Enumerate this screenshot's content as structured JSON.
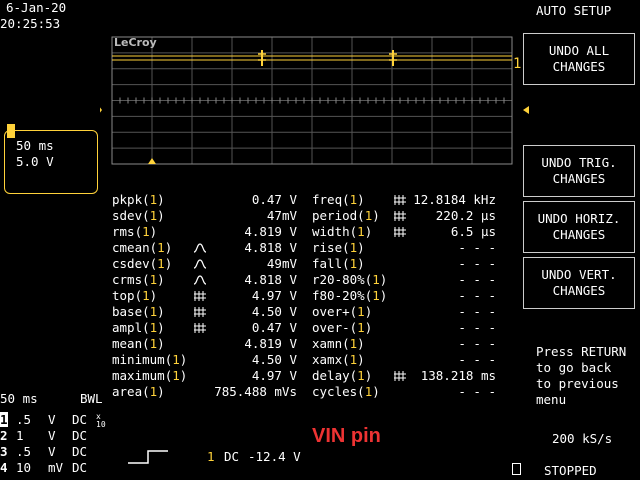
{
  "header": {
    "date": "6-Jan-20",
    "time": "20:25:53",
    "mode": "AUTO SETUP"
  },
  "grid": {
    "logo": "LeCroy"
  },
  "timebase_box": {
    "time_div": "50 ms",
    "volt_div": "5.0 V"
  },
  "buttons": [
    {
      "line1": "UNDO ALL",
      "line2": "CHANGES"
    },
    {
      "line1": "UNDO TRIG.",
      "line2": "CHANGES"
    },
    {
      "line1": "UNDO HORIZ.",
      "line2": "CHANGES"
    },
    {
      "line1": "UNDO VERT.",
      "line2": "CHANGES"
    }
  ],
  "measurements_left": [
    {
      "name": "pkpk",
      "value": "0.47 V",
      "icon": ""
    },
    {
      "name": "sdev",
      "value": "47mV",
      "icon": ""
    },
    {
      "name": "rms",
      "value": "4.819 V",
      "icon": ""
    },
    {
      "name": "cmean",
      "value": "4.818 V",
      "icon": "trend"
    },
    {
      "name": "csdev",
      "value": "49mV",
      "icon": "trend"
    },
    {
      "name": "crms",
      "value": "4.818 V",
      "icon": "trend"
    },
    {
      "name": "top",
      "value": "4.97 V",
      "icon": "jitter"
    },
    {
      "name": "base",
      "value": "4.50 V",
      "icon": "jitter"
    },
    {
      "name": "ampl",
      "value": "0.47 V",
      "icon": "jitter"
    },
    {
      "name": "mean",
      "value": "4.819 V",
      "icon": ""
    },
    {
      "name": "minimum",
      "value": "4.50 V",
      "icon": ""
    },
    {
      "name": "maximum",
      "value": "4.97 V",
      "icon": ""
    },
    {
      "name": "area",
      "value": "785.488 mVs",
      "icon": ""
    }
  ],
  "measurements_right": [
    {
      "name": "freq",
      "value": "12.8184 kHz",
      "icon": "jitter"
    },
    {
      "name": "period",
      "value": "220.2 µs",
      "icon": "jitter"
    },
    {
      "name": "width",
      "value": "6.5 µs",
      "icon": "jitter"
    },
    {
      "name": "rise",
      "value": "- - -",
      "icon": ""
    },
    {
      "name": "fall",
      "value": "- - -",
      "icon": ""
    },
    {
      "name": "r20-80%",
      "value": "- - -",
      "icon": ""
    },
    {
      "name": "f80-20%",
      "value": "- - -",
      "icon": ""
    },
    {
      "name": "over+",
      "value": "- - -",
      "icon": ""
    },
    {
      "name": "over-",
      "value": "- - -",
      "icon": ""
    },
    {
      "name": "xamn",
      "value": "- - -",
      "icon": ""
    },
    {
      "name": "xamx",
      "value": "- - -",
      "icon": ""
    },
    {
      "name": "delay",
      "value": "138.218 ms",
      "icon": "jitter"
    },
    {
      "name": "cycles",
      "value": "- - -",
      "icon": ""
    }
  ],
  "channel_suffix": "(1)",
  "bottom_left": {
    "timebase": "50 ms",
    "bwl": "BWL",
    "channels": [
      {
        "num": "1",
        "scale": ".5",
        "unit": "V",
        "coupling": "DC"
      },
      {
        "num": "2",
        "scale": "1",
        "unit": "V",
        "coupling": "DC"
      },
      {
        "num": "3",
        "scale": ".5",
        "unit": "V",
        "coupling": "DC"
      },
      {
        "num": "4",
        "scale": "10",
        "unit": "mV",
        "coupling": "DC"
      }
    ],
    "ch1_extra": "x\n10"
  },
  "trigger": {
    "channel": "1",
    "coupling": "DC",
    "level": "-12.4 V"
  },
  "annotation": "VIN pin",
  "side_info": {
    "hint": "Press RETURN\nto go back\nto previous\nmenu",
    "sample_rate": "200 kS/s",
    "state": "STOPPED"
  },
  "colors": {
    "trace": "#ffd23a",
    "annotation": "#e33333",
    "background": "#000000"
  }
}
